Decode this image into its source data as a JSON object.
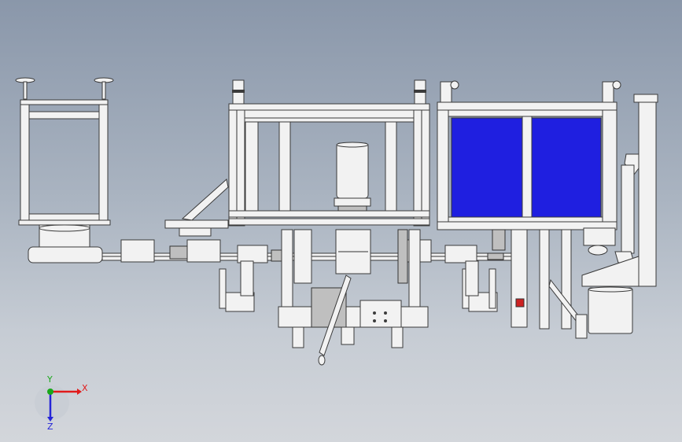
{
  "triad": {
    "x_label": "X",
    "y_label": "Y",
    "z_label": "Z"
  },
  "colors": {
    "background_top": "#8a97aa",
    "background_bottom": "#d3d6db",
    "panel_blue": "#1f1fe0",
    "x_axis": "#e11b1b",
    "y_axis": "#1aa81a",
    "z_axis": "#2424d8"
  }
}
